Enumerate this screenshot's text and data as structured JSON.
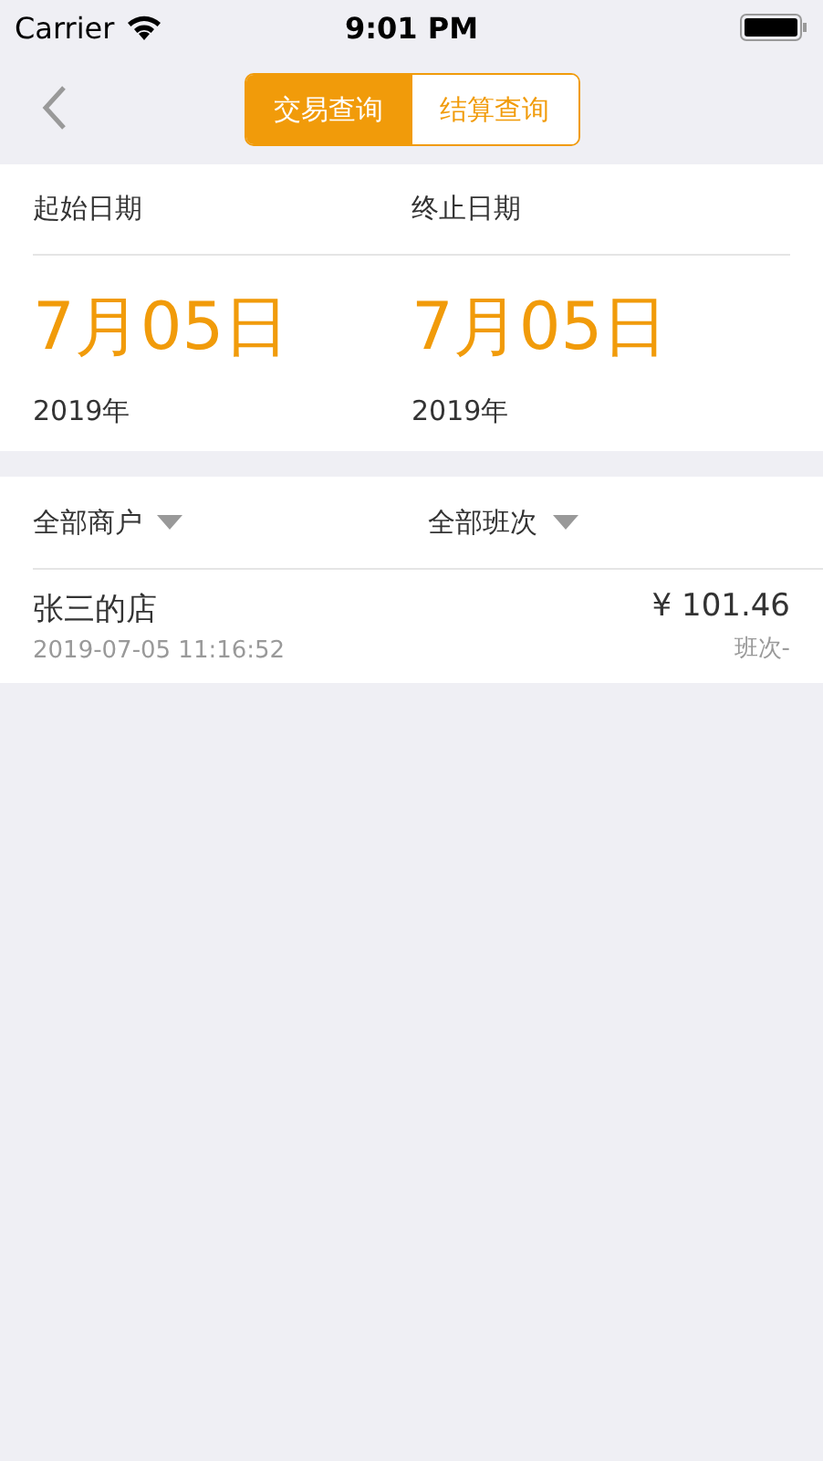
{
  "status_bar": {
    "carrier": "Carrier",
    "time": "9:01 PM"
  },
  "nav": {
    "segments": [
      {
        "label": "交易查询",
        "selected": true
      },
      {
        "label": "结算查询",
        "selected": false
      }
    ]
  },
  "dates": [
    {
      "label": "起始日期",
      "day": "7月05日",
      "year": "2019年"
    },
    {
      "label": "终止日期",
      "day": "7月05日",
      "year": "2019年"
    }
  ],
  "filters": [
    {
      "label": "全部商户"
    },
    {
      "label": "全部班次"
    }
  ],
  "records": [
    {
      "name": "张三的店",
      "time": "2019-07-05 11:16:52",
      "amount": "¥ 101.46",
      "shift": "班次-"
    }
  ]
}
